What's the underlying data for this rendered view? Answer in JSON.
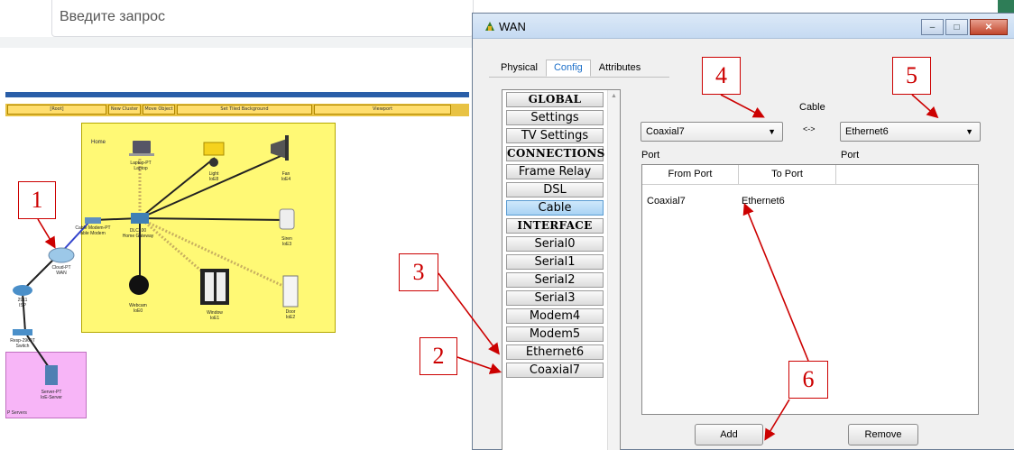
{
  "browser": {
    "search_placeholder": "Введите запрос"
  },
  "workspace": {
    "toolbar": [
      "[Root]",
      "New Cluster",
      "Move Object",
      "Set Tiled Background",
      "Viewport"
    ],
    "cluster_title": "Home",
    "servers_label": "P Servers",
    "devices": [
      {
        "name": "Laptop-PT",
        "sub": "Laptop"
      },
      {
        "name": "Light",
        "sub": "IoE8"
      },
      {
        "name": "Fan",
        "sub": "IoE4"
      },
      {
        "name": "Cable Modem-PT",
        "sub": "able Modem"
      },
      {
        "name": "DLC100",
        "sub": "Home Gateway"
      },
      {
        "name": "Siren",
        "sub": "IoE3"
      },
      {
        "name": "Cloud-PT",
        "sub": "WAN"
      },
      {
        "name": "2911",
        "sub": "ISP"
      },
      {
        "name": "Webcam",
        "sub": "IoE0"
      },
      {
        "name": "Window",
        "sub": "IoE1"
      },
      {
        "name": "Door",
        "sub": "IoE2"
      },
      {
        "name": "Resp-2960T",
        "sub": "Switch"
      },
      {
        "name": "Server-PT",
        "sub": "IoE-Server"
      }
    ]
  },
  "dialog": {
    "title": "WAN",
    "window_buttons": {
      "minimize": "–",
      "maximize": "□",
      "close": "✕"
    },
    "tabs": [
      {
        "label": "Physical",
        "active": false
      },
      {
        "label": "Config",
        "active": true
      },
      {
        "label": "Attributes",
        "active": false
      }
    ],
    "left_items": [
      {
        "label": "GLOBAL",
        "header": true
      },
      {
        "label": "Settings"
      },
      {
        "label": "TV Settings"
      },
      {
        "label": "CONNECTIONS",
        "header": true
      },
      {
        "label": "Frame Relay"
      },
      {
        "label": "DSL"
      },
      {
        "label": "Cable",
        "selected": true
      },
      {
        "label": "INTERFACE",
        "header": true
      },
      {
        "label": "Serial0"
      },
      {
        "label": "Serial1"
      },
      {
        "label": "Serial2"
      },
      {
        "label": "Serial3"
      },
      {
        "label": "Modem4"
      },
      {
        "label": "Modem5"
      },
      {
        "label": "Ethernet6"
      },
      {
        "label": "Coaxial7"
      }
    ],
    "cable_label": "Cable",
    "arrow_label": "<->",
    "from_select": {
      "value": "Coaxial7"
    },
    "to_select": {
      "value": "Ethernet6"
    },
    "from_port_label": "Port",
    "to_port_label": "Port",
    "table": {
      "columns": [
        "From Port",
        "To Port"
      ],
      "rows": [
        [
          "Coaxial7",
          "Ethernet6"
        ]
      ]
    },
    "add_label": "Add",
    "remove_label": "Remove"
  },
  "annotations": [
    "1",
    "2",
    "3",
    "4",
    "5",
    "6"
  ],
  "colors": {
    "annotation": "#cc0000",
    "cluster": "#fff975",
    "servers": "#f7b5f7",
    "tab_active": "#1c6fc9",
    "selected_item": "#a9d3f4"
  }
}
